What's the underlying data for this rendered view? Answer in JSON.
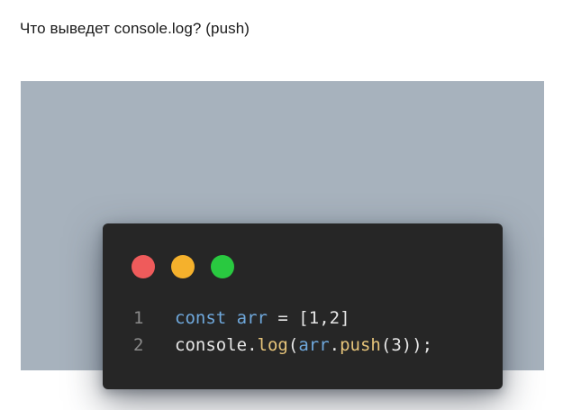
{
  "question": "Что выведет console.log? (push)",
  "code_window": {
    "dots": [
      {
        "name": "close-dot",
        "color": "#ef5b5b"
      },
      {
        "name": "minimize-dot",
        "color": "#f5b12c"
      },
      {
        "name": "maximize-dot",
        "color": "#29c940"
      }
    ],
    "lines": [
      {
        "number": "1",
        "tokens": [
          {
            "text": "const ",
            "color": "#6fa8dc"
          },
          {
            "text": "arr",
            "color": "#6fa8dc"
          },
          {
            "text": " = ",
            "color": "#e6e6e6"
          },
          {
            "text": "[",
            "color": "#e6e6e6"
          },
          {
            "text": "1",
            "color": "#e6e6e6"
          },
          {
            "text": ",",
            "color": "#e6e6e6"
          },
          {
            "text": "2",
            "color": "#e6e6e6"
          },
          {
            "text": "]",
            "color": "#e6e6e6"
          }
        ]
      },
      {
        "number": "2",
        "tokens": [
          {
            "text": "console",
            "color": "#e6e6e6"
          },
          {
            "text": ".",
            "color": "#e6e6e6"
          },
          {
            "text": "log",
            "color": "#e6c47a"
          },
          {
            "text": "(",
            "color": "#e6e6e6"
          },
          {
            "text": "arr",
            "color": "#6fa8dc"
          },
          {
            "text": ".",
            "color": "#e6e6e6"
          },
          {
            "text": "push",
            "color": "#e6c47a"
          },
          {
            "text": "(",
            "color": "#e6e6e6"
          },
          {
            "text": "3",
            "color": "#e6e6e6"
          },
          {
            "text": "));",
            "color": "#e6e6e6"
          }
        ]
      }
    ]
  }
}
